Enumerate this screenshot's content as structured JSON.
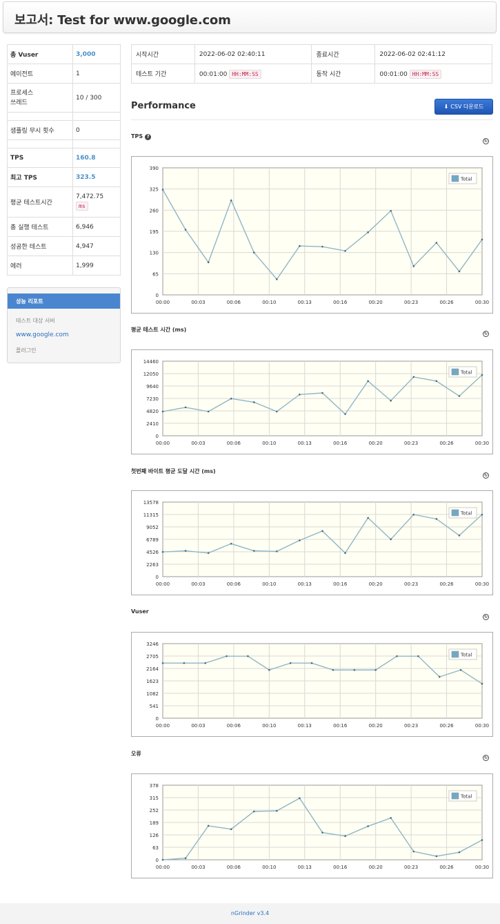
{
  "page": {
    "title": "보고서: Test for www.google.com"
  },
  "summary": {
    "rows": [
      {
        "label": "총 Vuser",
        "value": "3,000"
      },
      {
        "label": "에이전트",
        "value": "1"
      },
      {
        "label": "프로세스\n쓰레드",
        "value": "10 / 300"
      },
      {
        "label": "샘플링 무시 횟수",
        "value": "0"
      },
      {
        "label": "TPS",
        "value": "160.8"
      },
      {
        "label": "최고 TPS",
        "value": "323.5"
      },
      {
        "label": "평균 테스트시간",
        "value": "7,472.75",
        "unit": "ms"
      },
      {
        "label": "총 실행 테스트",
        "value": "6,946"
      },
      {
        "label": "성공한 테스트",
        "value": "4,947"
      },
      {
        "label": "에러",
        "value": "1,999"
      }
    ]
  },
  "sidepanel": {
    "header": "성능 리포트",
    "target_header": "테스트 대상 서버",
    "target_link": "www.google.com",
    "plugin_header": "플러그인"
  },
  "info": {
    "start_label": "시작시간",
    "start_value": "2022-06-02 02:40:11",
    "end_label": "종료시간",
    "end_value": "2022-06-02 02:41:12",
    "period_label": "테스트 기간",
    "period_value": "00:01:00",
    "period_unit": "HH:MM:SS",
    "run_label": "동작 시간",
    "run_value": "00:01:00",
    "run_unit": "HH:MM:SS"
  },
  "performance": {
    "title": "Performance",
    "csv_label": "CSV 다운로드"
  },
  "colors": {
    "line": "#8fb6c8",
    "plot_bg": "#fffff3",
    "grid": "#d8d8d8",
    "legend_swatch": "#6fa9c5"
  },
  "footer": {
    "text": "nGrinder v3.4"
  },
  "chart_data": [
    {
      "type": "line",
      "title": "TPS",
      "help": "?",
      "x": [
        "00:00",
        "00:03",
        "00:06",
        "00:10",
        "00:13",
        "00:16",
        "00:20",
        "00:23",
        "00:26",
        "00:30"
      ],
      "yticks": [
        "390",
        "325",
        "260",
        "195",
        "130",
        "65",
        "0"
      ],
      "ylim": [
        0,
        390
      ],
      "series": [
        {
          "name": "Total",
          "values": [
            323,
            200,
            100,
            290,
            130,
            48,
            150,
            148,
            135,
            192,
            258,
            88,
            160,
            72,
            170
          ]
        }
      ],
      "legend": "top-right",
      "grid": true
    },
    {
      "type": "line",
      "title": "평균 테스트 시간 (ms)",
      "x": [
        "00:00",
        "00:03",
        "00:06",
        "00:10",
        "00:13",
        "00:16",
        "00:20",
        "00:23",
        "00:26",
        "00:30"
      ],
      "yticks": [
        "14460",
        "12050",
        "9640",
        "7230",
        "4820",
        "2410",
        "0"
      ],
      "ylim": [
        0,
        14460
      ],
      "series": [
        {
          "name": "Total",
          "values": [
            4700,
            5500,
            4700,
            7200,
            6500,
            4700,
            8000,
            8300,
            4200,
            10600,
            6800,
            11400,
            10600,
            7700,
            11800
          ]
        }
      ],
      "legend": "top-right",
      "grid": true
    },
    {
      "type": "line",
      "title": "첫번째 바이트 평균 도달 시간 (ms)",
      "x": [
        "00:00",
        "00:03",
        "00:06",
        "00:10",
        "00:13",
        "00:16",
        "00:20",
        "00:23",
        "00:26",
        "00:30"
      ],
      "yticks": [
        "13578",
        "11315",
        "9052",
        "6789",
        "4526",
        "2263",
        "0"
      ],
      "ylim": [
        0,
        13578
      ],
      "series": [
        {
          "name": "Total",
          "values": [
            4500,
            4700,
            4300,
            6000,
            4700,
            4600,
            6600,
            8300,
            4300,
            10700,
            6800,
            11300,
            10500,
            7500,
            11300
          ]
        }
      ],
      "legend": "top-right",
      "grid": true
    },
    {
      "type": "line",
      "title": "Vuser",
      "x": [
        "00:00",
        "00:03",
        "00:06",
        "00:10",
        "00:13",
        "00:16",
        "00:20",
        "00:23",
        "00:26",
        "00:30"
      ],
      "yticks": [
        "3246",
        "2705",
        "2164",
        "1623",
        "1082",
        "541",
        "0"
      ],
      "ylim": [
        0,
        3246
      ],
      "series": [
        {
          "name": "Total",
          "values": [
            2400,
            2400,
            2400,
            2700,
            2700,
            2100,
            2400,
            2400,
            2100,
            2100,
            2100,
            2700,
            2700,
            1800,
            2100,
            1500
          ]
        }
      ],
      "legend": "top-right",
      "grid": true
    },
    {
      "type": "line",
      "title": "오류",
      "x": [
        "00:00",
        "00:03",
        "00:06",
        "00:10",
        "00:13",
        "00:16",
        "00:20",
        "00:23",
        "00:26",
        "00:30"
      ],
      "yticks": [
        "378",
        "315",
        "252",
        "189",
        "126",
        "63",
        "0"
      ],
      "ylim": [
        0,
        378
      ],
      "series": [
        {
          "name": "Total",
          "values": [
            0,
            8,
            172,
            155,
            245,
            248,
            312,
            138,
            120,
            170,
            212,
            42,
            18,
            38,
            100
          ]
        }
      ],
      "legend": "top-right",
      "grid": true
    }
  ]
}
